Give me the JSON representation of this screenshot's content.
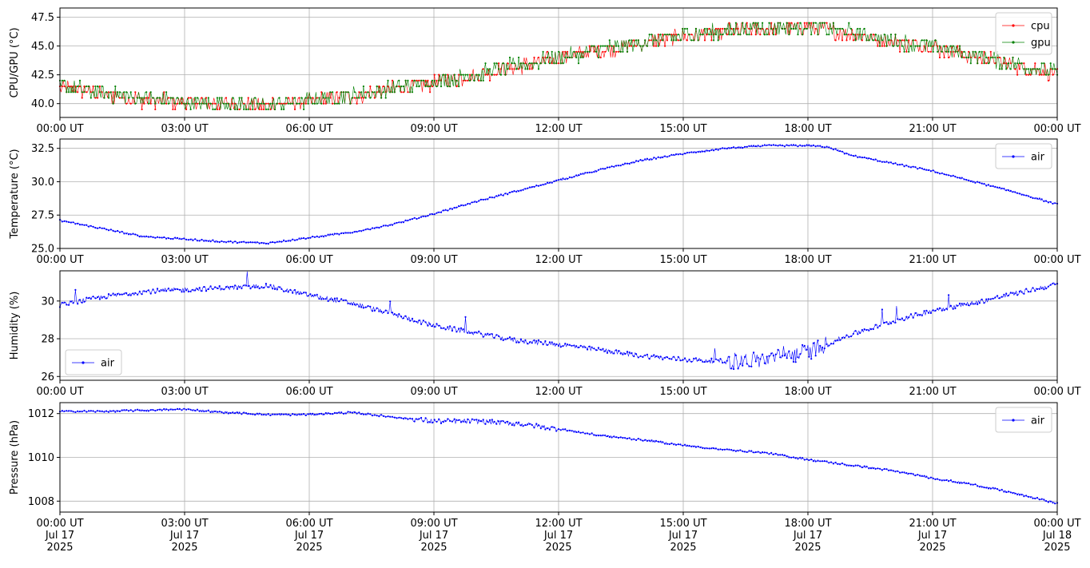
{
  "colors": {
    "cpu": "#ff0000",
    "gpu": "#008000",
    "air": "#0000ff",
    "grid": "#b0b0b0",
    "axes": "#000000"
  },
  "chart_data": [
    {
      "type": "line",
      "ylabel": "CPU/GPU (°C)",
      "xlim": [
        "2025-07-17 00:00",
        "2025-07-18 00:00"
      ],
      "ylim": [
        38.8,
        48.3
      ],
      "yticks": [
        "40.0",
        "42.5",
        "45.0",
        "47.5"
      ],
      "xticks": [
        "00:00 UT",
        "03:00 UT",
        "06:00 UT",
        "09:00 UT",
        "12:00 UT",
        "15:00 UT",
        "18:00 UT",
        "21:00 UT",
        "00:00 UT"
      ],
      "grid": true,
      "legend": "top-right",
      "series": [
        {
          "name": "cpu",
          "color": "#ff0000",
          "hours": [
            0,
            1,
            2,
            3,
            4,
            5,
            6,
            7,
            8,
            9,
            10,
            11,
            12,
            13,
            14,
            15,
            16,
            17,
            18,
            19,
            20,
            21,
            22,
            23,
            24
          ],
          "values": [
            41.5,
            40.8,
            40.3,
            40.1,
            40.0,
            39.9,
            40.2,
            40.6,
            41.2,
            41.8,
            42.4,
            43.2,
            43.9,
            44.6,
            45.2,
            45.8,
            46.2,
            46.5,
            46.6,
            46.1,
            45.4,
            44.9,
            44.1,
            43.3,
            42.6
          ]
        },
        {
          "name": "gpu",
          "color": "#008000",
          "hours": [
            0,
            1,
            2,
            3,
            4,
            5,
            6,
            7,
            8,
            9,
            10,
            11,
            12,
            13,
            14,
            15,
            16,
            17,
            18,
            19,
            20,
            21,
            22,
            23,
            24
          ],
          "values": [
            41.6,
            40.9,
            40.4,
            40.1,
            40.0,
            39.9,
            40.3,
            40.7,
            41.3,
            41.9,
            42.5,
            43.3,
            44.0,
            44.7,
            45.3,
            45.9,
            46.3,
            46.6,
            46.7,
            46.2,
            45.5,
            45.0,
            44.2,
            43.4,
            42.7
          ]
        }
      ]
    },
    {
      "type": "line",
      "ylabel": "Temperature (°C)",
      "xlim": [
        "2025-07-17 00:00",
        "2025-07-18 00:00"
      ],
      "ylim": [
        25.0,
        33.2
      ],
      "yticks": [
        "25.0",
        "27.5",
        "30.0",
        "32.5"
      ],
      "xticks": [
        "00:00 UT",
        "03:00 UT",
        "06:00 UT",
        "09:00 UT",
        "12:00 UT",
        "15:00 UT",
        "18:00 UT",
        "21:00 UT",
        "00:00 UT"
      ],
      "grid": true,
      "legend": "top-right",
      "series": [
        {
          "name": "air",
          "color": "#0000ff",
          "hours": [
            0,
            1,
            2,
            3,
            4,
            5,
            6,
            7,
            8,
            9,
            10,
            11,
            12,
            13,
            14,
            15,
            16,
            17,
            18,
            18.5,
            19,
            20,
            21,
            22,
            23,
            24
          ],
          "values": [
            27.1,
            26.5,
            25.9,
            25.7,
            25.5,
            25.4,
            25.8,
            26.2,
            26.8,
            27.6,
            28.5,
            29.3,
            30.1,
            30.9,
            31.6,
            32.1,
            32.5,
            32.7,
            32.7,
            32.6,
            32.0,
            31.4,
            30.8,
            30.0,
            29.2,
            28.3
          ]
        }
      ]
    },
    {
      "type": "line",
      "ylabel": "Humidity (%)",
      "xlim": [
        "2025-07-17 00:00",
        "2025-07-18 00:00"
      ],
      "ylim": [
        25.8,
        31.6
      ],
      "yticks": [
        "26",
        "28",
        "30"
      ],
      "xticks": [
        "00:00 UT",
        "03:00 UT",
        "06:00 UT",
        "09:00 UT",
        "12:00 UT",
        "15:00 UT",
        "18:00 UT",
        "21:00 UT",
        "00:00 UT"
      ],
      "grid": true,
      "legend": "bottom-left",
      "series": [
        {
          "name": "air",
          "color": "#0000ff",
          "hours": [
            0,
            1,
            2,
            3,
            4,
            5,
            6,
            7,
            8,
            9,
            10,
            11,
            12,
            13,
            14,
            15,
            16,
            17,
            18,
            19,
            20,
            21,
            22,
            23,
            24
          ],
          "values": [
            29.8,
            30.2,
            30.5,
            30.6,
            30.7,
            30.8,
            30.3,
            29.9,
            29.3,
            28.7,
            28.3,
            27.9,
            27.7,
            27.4,
            27.1,
            26.9,
            26.8,
            26.9,
            27.3,
            28.2,
            28.9,
            29.5,
            29.9,
            30.4,
            30.9
          ]
        }
      ]
    },
    {
      "type": "line",
      "ylabel": "Pressure (hPa)",
      "xlim": [
        "2025-07-17 00:00",
        "2025-07-18 00:00"
      ],
      "ylim": [
        1007.5,
        1012.5
      ],
      "yticks": [
        "1008",
        "1010",
        "1012"
      ],
      "xticks": [
        "00:00 UT\nJul 17\n2025",
        "03:00 UT\nJul 17\n2025",
        "06:00 UT\nJul 17\n2025",
        "09:00 UT\nJul 17\n2025",
        "12:00 UT\nJul 17\n2025",
        "15:00 UT\nJul 17\n2025",
        "18:00 UT\nJul 17\n2025",
        "21:00 UT\nJul 17\n2025",
        "00:00 UT\nJul 18\n2025"
      ],
      "grid": true,
      "legend": "top-right",
      "series": [
        {
          "name": "air",
          "color": "#0000ff",
          "hours": [
            0,
            1,
            2,
            3,
            4,
            5,
            6,
            7,
            8,
            9,
            10,
            11,
            12,
            13,
            14,
            15,
            16,
            17,
            18,
            19,
            20,
            21,
            22,
            23,
            24
          ],
          "values": [
            1012.1,
            1012.1,
            1012.15,
            1012.2,
            1012.05,
            1011.95,
            1011.95,
            1012.05,
            1011.85,
            1011.65,
            1011.65,
            1011.55,
            1011.3,
            1011.0,
            1010.8,
            1010.55,
            1010.35,
            1010.2,
            1009.9,
            1009.65,
            1009.4,
            1009.05,
            1008.75,
            1008.35,
            1007.9
          ]
        }
      ]
    }
  ]
}
